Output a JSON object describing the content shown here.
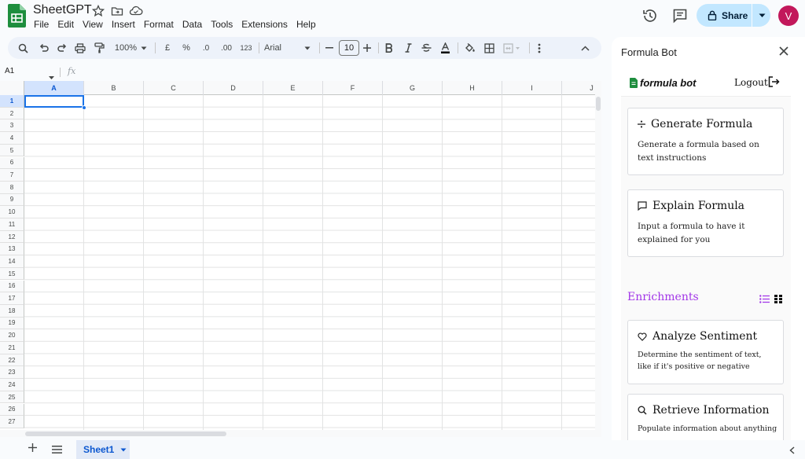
{
  "app": {
    "doc_title": "SheetGPT",
    "menu": [
      "File",
      "Edit",
      "View",
      "Insert",
      "Format",
      "Data",
      "Tools",
      "Extensions",
      "Help"
    ],
    "share_label": "Share",
    "avatar_initial": "V",
    "accent": "#0b57d0",
    "share_bg": "#c2e7ff",
    "avatar_bg": "#c2185b"
  },
  "toolbar": {
    "zoom": "100%",
    "currency": "£",
    "percent": "%",
    "decrease_decimal": ".0",
    "increase_decimal": ".00",
    "number_format": "123",
    "font": "Arial",
    "font_size": "10"
  },
  "formula_bar": {
    "name_box": "A1",
    "fx": "fx"
  },
  "grid": {
    "columns": [
      "A",
      "B",
      "C",
      "D",
      "E",
      "F",
      "G",
      "H",
      "I",
      "J"
    ],
    "rows": [
      "1",
      "2",
      "3",
      "4",
      "5",
      "6",
      "7",
      "8",
      "9",
      "10",
      "11",
      "12",
      "13",
      "14",
      "15",
      "16",
      "17",
      "18",
      "19",
      "20",
      "21",
      "22",
      "23",
      "24",
      "25",
      "26",
      "27"
    ],
    "selected_column": "A",
    "selected_row": "1"
  },
  "sheets": {
    "tabs": [
      "Sheet1"
    ]
  },
  "panel": {
    "title": "Formula Bot",
    "brand": "formula bot",
    "logout": "Logout",
    "cards": [
      {
        "title": "Generate Formula",
        "desc": "Generate a formula based on text instructions",
        "icon": "divide-icon"
      },
      {
        "title": "Explain Formula",
        "desc": "Input a formula to have it explained for you",
        "icon": "comment-icon"
      }
    ],
    "enrichments_title": "Enrichments",
    "enrichments": [
      {
        "title": "Analyze Sentiment",
        "desc": "Determine the sentiment of text, like if it's positive or negative",
        "icon": "heart-icon"
      },
      {
        "title": "Retrieve Information",
        "desc": "Populate information about anything",
        "icon": "search-icon"
      }
    ],
    "enrichments_color": "#a236e8"
  }
}
